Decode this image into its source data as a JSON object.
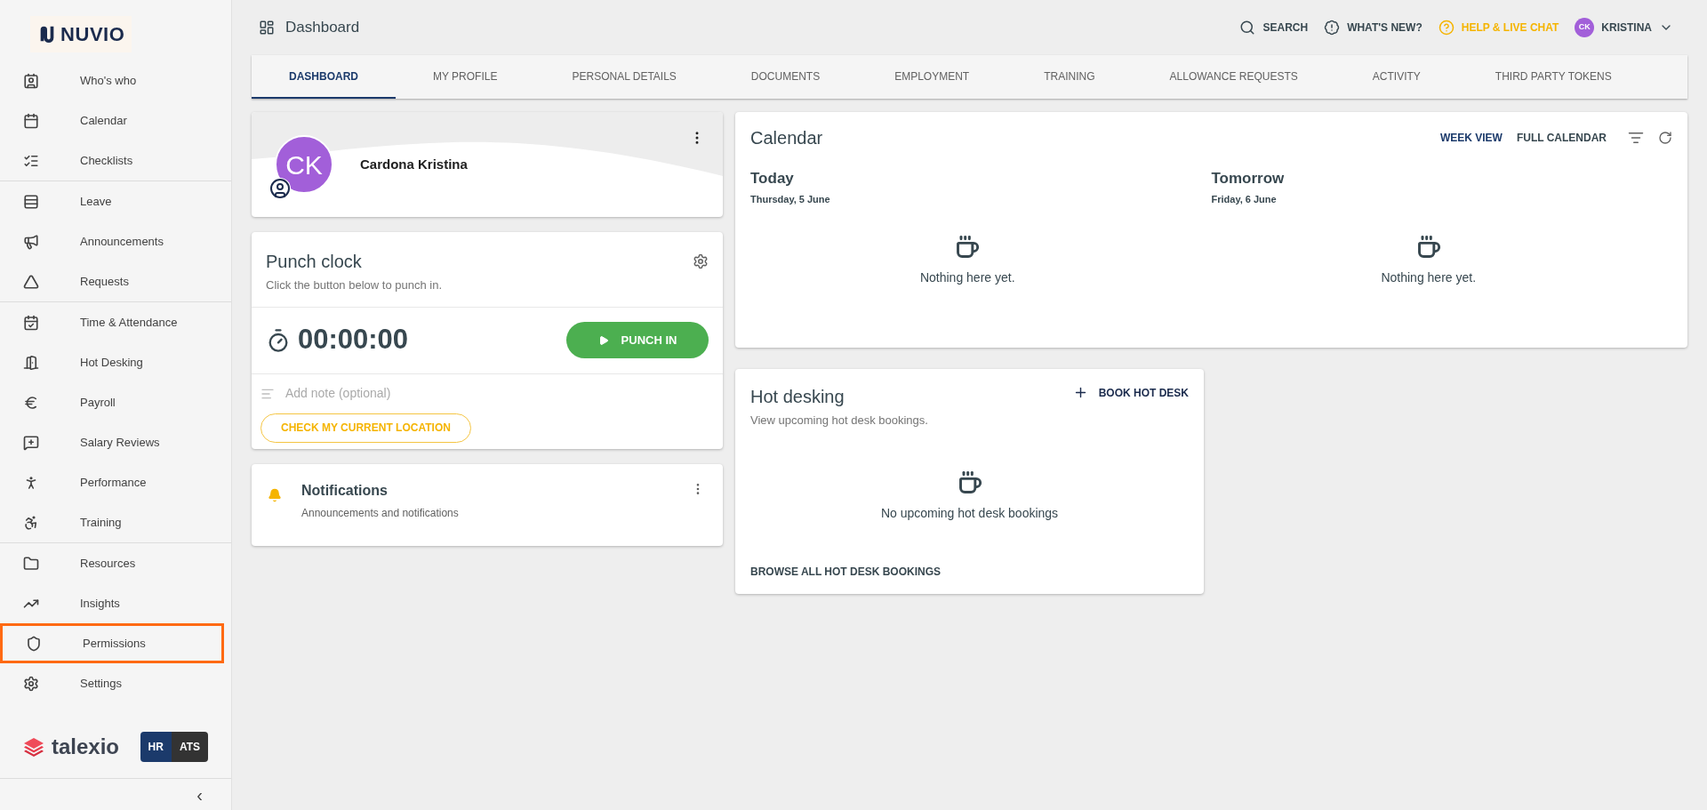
{
  "sidebar": {
    "logo": "NUVIO",
    "groups": [
      [
        {
          "label": "Who's who",
          "highlighted": false
        },
        {
          "label": "Calendar",
          "highlighted": false
        },
        {
          "label": "Checklists",
          "highlighted": false
        }
      ],
      [
        {
          "label": "Leave",
          "highlighted": false
        },
        {
          "label": "Announcements",
          "highlighted": false
        },
        {
          "label": "Requests",
          "highlighted": false
        }
      ],
      [
        {
          "label": "Time & Attendance",
          "highlighted": false
        },
        {
          "label": "Hot Desking",
          "highlighted": false
        },
        {
          "label": "Payroll",
          "highlighted": false
        },
        {
          "label": "Salary Reviews",
          "highlighted": false
        },
        {
          "label": "Performance",
          "highlighted": false
        },
        {
          "label": "Training",
          "highlighted": false
        }
      ],
      [
        {
          "label": "Resources",
          "highlighted": false
        },
        {
          "label": "Insights",
          "highlighted": false
        },
        {
          "label": "Permissions",
          "highlighted": true
        },
        {
          "label": "Settings",
          "highlighted": false
        }
      ]
    ],
    "brand": "talexio",
    "modes": [
      {
        "label": "HR",
        "selected": true
      },
      {
        "label": "ATS",
        "selected": false
      }
    ],
    "collapse": "‹"
  },
  "header": {
    "title": "Dashboard",
    "actions": [
      {
        "kind": "search",
        "label": "SEARCH"
      },
      {
        "kind": "news",
        "label": "WHAT'S NEW?"
      },
      {
        "kind": "help",
        "label": "HELP & LIVE CHAT"
      }
    ],
    "user": {
      "initials": "CK",
      "name": "KRISTINA"
    }
  },
  "tabs": [
    {
      "label": "DASHBOARD",
      "selected": true
    },
    {
      "label": "MY PROFILE",
      "selected": false
    },
    {
      "label": "PERSONAL DETAILS",
      "selected": false
    },
    {
      "label": "DOCUMENTS",
      "selected": false
    },
    {
      "label": "EMPLOYMENT",
      "selected": false
    },
    {
      "label": "TRAINING",
      "selected": false
    },
    {
      "label": "ALLOWANCE REQUESTS",
      "selected": false
    },
    {
      "label": "ACTIVITY",
      "selected": false
    },
    {
      "label": "THIRD PARTY TOKENS",
      "selected": false
    }
  ],
  "profile": {
    "initials": "CK",
    "name": "Cardona Kristina"
  },
  "punch_clock": {
    "title": "Punch clock",
    "subtitle": "Click the button below to punch in.",
    "timer": "00:00:00",
    "button": "PUNCH IN",
    "note_placeholder": "Add note (optional)",
    "location_button": "CHECK MY CURRENT LOCATION"
  },
  "notifications": {
    "title": "Notifications",
    "subtitle": "Announcements and notifications"
  },
  "calendar": {
    "title": "Calendar",
    "actions": [
      "WEEK VIEW",
      "FULL CALENDAR"
    ],
    "days": [
      {
        "heading": "Today",
        "date": "Thursday, 5 June",
        "empty": "Nothing here yet."
      },
      {
        "heading": "Tomorrow",
        "date": "Friday, 6 June",
        "empty": "Nothing here yet."
      }
    ]
  },
  "hot_desking": {
    "title": "Hot desking",
    "subtitle": "View upcoming hot desk bookings.",
    "book": "BOOK HOT DESK",
    "empty": "No upcoming hot desk bookings",
    "browse": "BROWSE ALL HOT DESK BOOKINGS"
  }
}
